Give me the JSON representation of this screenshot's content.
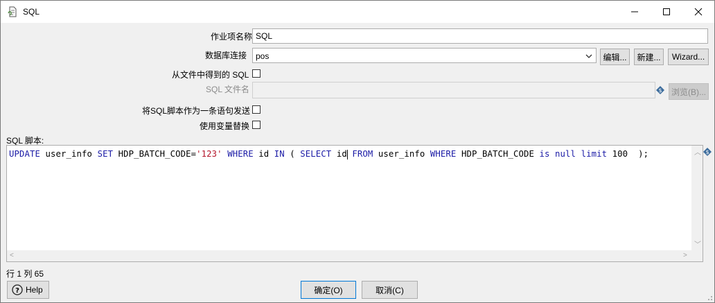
{
  "window": {
    "title": "SQL"
  },
  "form": {
    "step_name_label": "作业项名称",
    "step_name_value": "SQL",
    "db_connection_label": "数据库连接",
    "db_connection_value": "pos",
    "edit_button": "编辑...",
    "new_button": "新建...",
    "wizard_button": "Wizard...",
    "from_file_label": "从文件中得到的 SQL",
    "from_file_checked": false,
    "sql_filename_label": "SQL 文件名",
    "sql_filename_value": "",
    "browse_button": "浏览(B)...",
    "send_single_label": "将SQL脚本作为一条语句发送",
    "send_single_checked": false,
    "use_variable_label": "使用变量替换",
    "use_variable_checked": false,
    "sql_script_label": "SQL 脚本:"
  },
  "editor": {
    "tokens": [
      {
        "t": "UPDATE",
        "c": "kw"
      },
      {
        "t": " user_info ",
        "c": "id"
      },
      {
        "t": "SET",
        "c": "kw"
      },
      {
        "t": " HDP_BATCH_CODE=",
        "c": "id"
      },
      {
        "t": "'123'",
        "c": "str"
      },
      {
        "t": " ",
        "c": "id"
      },
      {
        "t": "WHERE",
        "c": "kw"
      },
      {
        "t": " id ",
        "c": "id"
      },
      {
        "t": "IN",
        "c": "kw"
      },
      {
        "t": " ( ",
        "c": "id"
      },
      {
        "t": "SELECT",
        "c": "kw"
      },
      {
        "t": " id",
        "c": "id"
      },
      {
        "t": "|caret|",
        "c": "caret"
      },
      {
        "t": " ",
        "c": "id"
      },
      {
        "t": "FROM",
        "c": "kw"
      },
      {
        "t": " user_info ",
        "c": "id"
      },
      {
        "t": "WHERE",
        "c": "kw"
      },
      {
        "t": " HDP_BATCH_CODE ",
        "c": "id"
      },
      {
        "t": "is",
        "c": "kw"
      },
      {
        "t": " ",
        "c": "id"
      },
      {
        "t": "null",
        "c": "kw"
      },
      {
        "t": " ",
        "c": "id"
      },
      {
        "t": "limit",
        "c": "kw"
      },
      {
        "t": " 100  );",
        "c": "id"
      }
    ]
  },
  "status": {
    "position_text": "行 1 列 65"
  },
  "footer": {
    "help_button": "Help",
    "ok_button": "确定(O)",
    "cancel_button": "取消(C)"
  },
  "colors": {
    "keyword": "#1a1aa6",
    "string": "#b5162b",
    "variable_icon": "#3c6c9c"
  }
}
